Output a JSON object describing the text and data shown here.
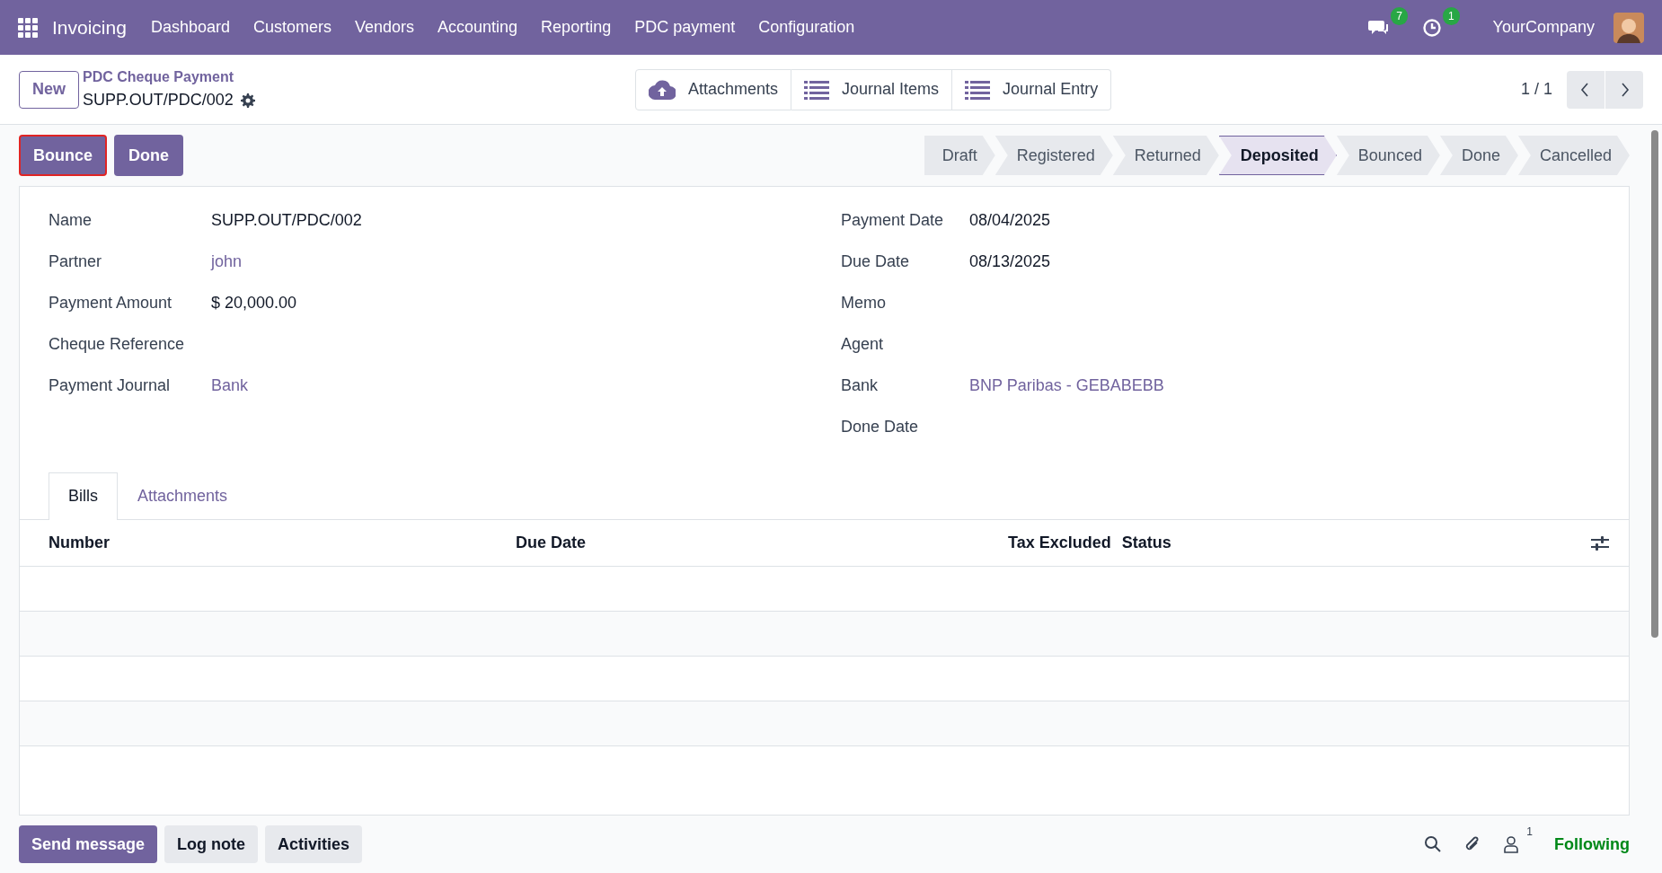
{
  "navbar": {
    "app": "Invoicing",
    "menus": [
      "Dashboard",
      "Customers",
      "Vendors",
      "Accounting",
      "Reporting",
      "PDC payment",
      "Configuration"
    ],
    "messages_count": "7",
    "activities_count": "1",
    "company": "YourCompany"
  },
  "control_panel": {
    "new_button": "New",
    "breadcrumb": "PDC Cheque Payment",
    "record": "SUPP.OUT/PDC/002",
    "smart_buttons": [
      {
        "label": "Attachments",
        "kind": "upload"
      },
      {
        "label": "Journal Items",
        "kind": "list"
      },
      {
        "label": "Journal Entry",
        "kind": "list"
      }
    ],
    "pager": "1 / 1"
  },
  "actions": [
    {
      "label": "Bounce",
      "highlighted": true
    },
    {
      "label": "Done",
      "highlighted": false
    }
  ],
  "statusbar": [
    {
      "label": "Draft",
      "selected": false
    },
    {
      "label": "Registered",
      "selected": false
    },
    {
      "label": "Returned",
      "selected": false
    },
    {
      "label": "Deposited",
      "selected": true
    },
    {
      "label": "Bounced",
      "selected": false
    },
    {
      "label": "Done",
      "selected": false
    },
    {
      "label": "Cancelled",
      "selected": false
    }
  ],
  "left_fields": [
    {
      "label": "Name",
      "value": "SUPP.OUT/PDC/002",
      "kind": "text"
    },
    {
      "label": "Partner",
      "value": "john",
      "kind": "link"
    },
    {
      "label": "Payment Amount",
      "value": "$ 20,000.00",
      "kind": "text"
    },
    {
      "label": "Cheque Reference"
    },
    {
      "label": "Payment Journal",
      "value": "Bank",
      "kind": "link"
    }
  ],
  "right_fields": [
    {
      "label": "Payment Date",
      "value": "08/04/2025",
      "kind": "text"
    },
    {
      "label": "Due Date",
      "value": "08/13/2025",
      "kind": "text"
    },
    {
      "label": "Memo"
    },
    {
      "label": "Agent"
    },
    {
      "label": "Bank",
      "value": "BNP Paribas - GEBABEBB",
      "kind": "link"
    },
    {
      "label": "Done Date"
    }
  ],
  "tabs": [
    {
      "label": "Bills",
      "selected": true
    },
    {
      "label": "Attachments",
      "selected": false
    }
  ],
  "table": {
    "columns": [
      "Number",
      "Due Date",
      "Tax Excluded",
      "Status"
    ]
  },
  "chatter": {
    "buttons": [
      {
        "label": "Send message",
        "selected": true
      },
      {
        "label": "Log note",
        "selected": false
      },
      {
        "label": "Activities",
        "selected": false
      }
    ],
    "followers_count": "1",
    "follow_label": "Following"
  }
}
